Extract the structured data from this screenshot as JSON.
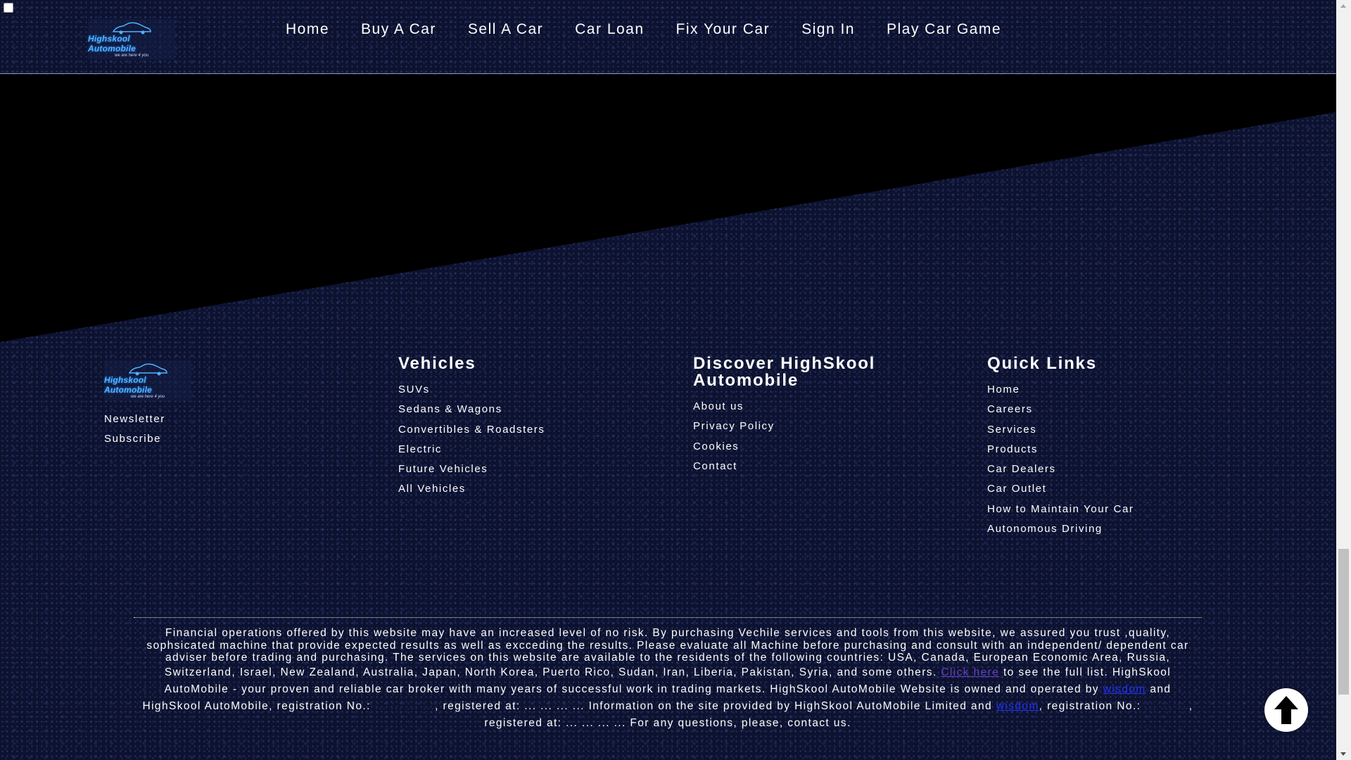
{
  "brand": {
    "name": "Highskool Automobile",
    "tagline": "we are here 4 you",
    "accent_color": "#4fb3ff"
  },
  "nav": {
    "items": [
      "Home",
      "Buy A Car",
      "Sell A Car",
      "Car Loan",
      "Fix Your Car",
      "Sign In",
      "Play Car Game"
    ]
  },
  "footer": {
    "brand_col": {
      "items": [
        "Newsletter",
        "Subscribe"
      ]
    },
    "vehicles": {
      "title": "Vehicles",
      "items": [
        "SUVs",
        "Sedans & Wagons",
        "Convertibles & Roadsters",
        "Electric",
        "Future Vehicles",
        "All Vehicles"
      ]
    },
    "discover": {
      "title": "Discover HighSkool Automobile",
      "items": [
        "About us",
        "Privacy Policy",
        "Cookies",
        "Contact"
      ]
    },
    "quick_links": {
      "title": "Quick Links",
      "items": [
        "Home",
        "Careers",
        "Services",
        "Products",
        "Car Dealers",
        "Car Outlet",
        "How to Maintain Your Car",
        "Autonomous Driving"
      ]
    }
  },
  "disclaimer": {
    "part1": "Financial operations offered by this website may have an increased level of no risk. By purchasing Vechile services and tools from this website, we assured you trust ,quality, sophsicated machine that provide expected results as well as excceding the results. Please evaluate all Machine before purchasing and consult with an independent/ dependent car adviser before trading and purchasing. The services on this website are available to the residents of the following countries: USA, Canada, European Economic Area, Russia, Switzerland, Israel, New Zealand, Australia, Japan, North Korea, Puerto Rico, Sudan, Iran, Liberia, Pakistan, Syria, and some others.",
    "click_here": "Click here",
    "part2": "to see the full list. HighSkool AutoMobile - your proven and reliable car broker with many years of successful work in trading markets. HighSkool AutoMobile Website is owned and operated by",
    "wisdom_1": "wisdom",
    "part3": "and HighSkool AutoMobile, registration No.:",
    "redacted_1": "... ... ... ...",
    "part4": ", registered at: ... ... ... ... Information on the site provided by HighSkool AutoMobile Limited and",
    "wisdom_2": "wisdom",
    "part5": ", registration No.:",
    "redacted_2": "... ... ...",
    "part6": ", registered at: ... ... ... ... For any questions, please, contact us."
  },
  "icons": {
    "scroll_top": "arrow-up-icon",
    "logo_car": "car-icon"
  }
}
